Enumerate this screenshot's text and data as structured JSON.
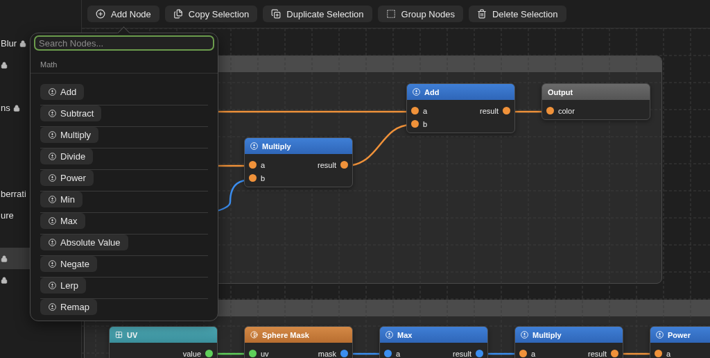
{
  "sidebar": {
    "items": [
      {
        "label": "Blur",
        "locked": true,
        "selected": false
      },
      {
        "locked": true,
        "selected": false
      },
      {
        "locked": false,
        "selected": false
      },
      {
        "label": "ns",
        "locked": true,
        "selected": false
      },
      {
        "locked": false,
        "selected": false
      },
      {
        "locked": false,
        "selected": false
      },
      {
        "locked": false,
        "selected": false
      },
      {
        "label": "berrati",
        "locked": false,
        "selected": false
      },
      {
        "label": "ure",
        "locked": false,
        "selected": false
      },
      {
        "locked": false,
        "selected": false
      },
      {
        "locked": true,
        "selected": true
      },
      {
        "locked": true,
        "selected": false
      }
    ]
  },
  "toolbar": [
    {
      "label": "Add Node",
      "kind": "add"
    },
    {
      "label": "Copy Selection",
      "kind": "copy"
    },
    {
      "label": "Duplicate Selection",
      "kind": "duplicate"
    },
    {
      "label": "Group Nodes",
      "kind": "group"
    },
    {
      "label": "Delete Selection",
      "kind": "delete"
    }
  ],
  "popup": {
    "search": {
      "placeholder": "Search Nodes...",
      "focused": true
    },
    "section": "Math",
    "items": [
      "Add",
      "Subtract",
      "Multiply",
      "Divide",
      "Power",
      "Min",
      "Max",
      "Absolute Value",
      "Negate",
      "Lerp",
      "Remap"
    ]
  },
  "nodes": [
    {
      "title": "Add",
      "kind": "math",
      "inputs": [
        {
          "name": "a",
          "color": "#f0923a"
        },
        {
          "name": "b",
          "color": "#f0923a"
        }
      ],
      "outputs": [
        {
          "name": "result",
          "color": "#f0923a"
        }
      ]
    },
    {
      "title": "Output",
      "kind": "output",
      "inputs": [
        {
          "name": "color",
          "color": "#f0923a"
        }
      ]
    },
    {
      "title": "Multiply",
      "kind": "math",
      "inputs": [
        {
          "name": "a",
          "color": "#f0923a"
        },
        {
          "name": "b",
          "color": "#f0923a"
        }
      ],
      "outputs": [
        {
          "name": "result",
          "color": "#f0923a"
        }
      ]
    },
    {
      "title": "UV",
      "kind": "uv",
      "outputs": [
        {
          "name": "value",
          "color": "#5fcf5a"
        }
      ]
    },
    {
      "title": "Sphere Mask",
      "kind": "mask",
      "inputs": [
        {
          "name": "uv",
          "color": "#5fcf5a"
        }
      ],
      "outputs": [
        {
          "name": "mask",
          "color": "#3b8ef0"
        }
      ]
    },
    {
      "title": "Max",
      "kind": "math",
      "inputs": [
        {
          "name": "a",
          "color": "#3b8ef0"
        }
      ],
      "outputs": [
        {
          "name": "result",
          "color": "#3b8ef0"
        }
      ]
    },
    {
      "title": "Multiply",
      "kind": "math",
      "inputs": [
        {
          "name": "a",
          "color": "#f0923a"
        }
      ],
      "outputs": [
        {
          "name": "result",
          "color": "#f0923a"
        }
      ]
    },
    {
      "title": "Power",
      "kind": "math",
      "inputs": [
        {
          "name": "a",
          "color": "#f0923a"
        }
      ]
    }
  ]
}
